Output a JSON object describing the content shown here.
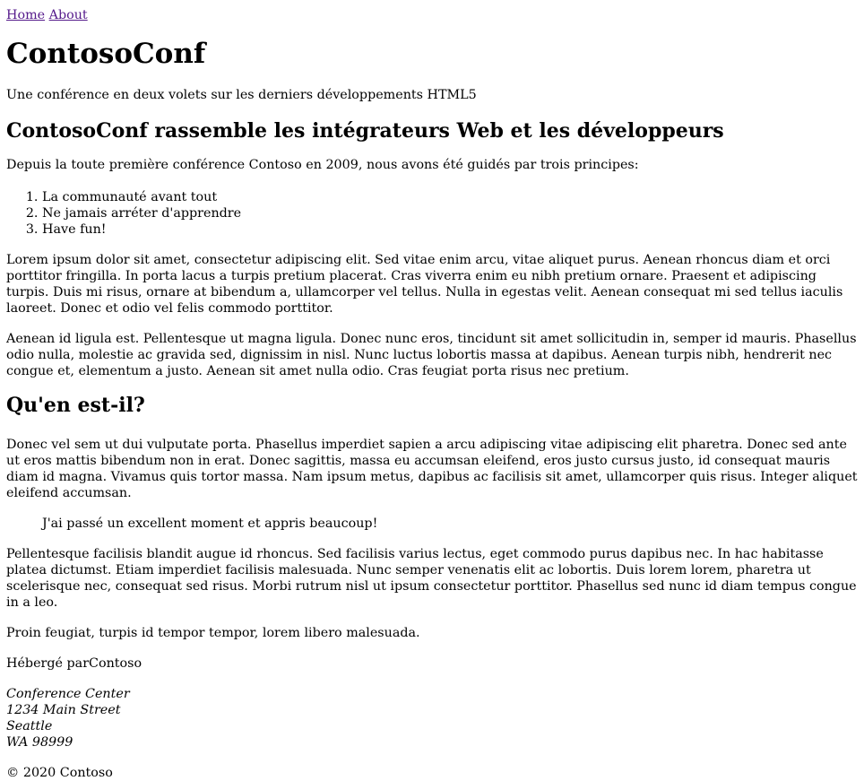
{
  "nav": {
    "home": "Home",
    "about": "About"
  },
  "header": {
    "title": "ContosoConf",
    "tagline": "Une conférence en deux volets sur les derniers développements HTML5"
  },
  "section1": {
    "heading": "ContosoConf rassemble les intégrateurs Web et les développeurs",
    "intro": "Depuis la toute première conférence Contoso en 2009, nous avons été guidés par trois principes:",
    "principles": [
      "La communauté avant tout",
      "Ne jamais arréter d'apprendre",
      "Have fun!"
    ],
    "p1": "Lorem ipsum dolor sit amet, consectetur adipiscing elit. Sed vitae enim arcu, vitae aliquet purus. Aenean rhoncus diam et orci porttitor fringilla. In porta lacus a turpis pretium placerat. Cras viverra enim eu nibh pretium ornare. Praesent et adipiscing turpis. Duis mi risus, ornare at bibendum a, ullamcorper vel tellus. Nulla in egestas velit. Aenean consequat mi sed tellus iaculis laoreet. Donec et odio vel felis commodo porttitor.",
    "p2": "Aenean id ligula est. Pellentesque ut magna ligula. Donec nunc eros, tincidunt sit amet sollicitudin in, semper id mauris. Phasellus odio nulla, molestie ac gravida sed, dignissim in nisl. Nunc luctus lobortis massa at dapibus. Aenean turpis nibh, hendrerit nec congue et, elementum a justo. Aenean sit amet nulla odio. Cras feugiat porta risus nec pretium."
  },
  "section2": {
    "heading": "Qu'en est-il?",
    "p1": "Donec vel sem ut dui vulputate porta. Phasellus imperdiet sapien a arcu adipiscing vitae adipiscing elit pharetra. Donec sed ante ut eros mattis bibendum non in erat. Donec sagittis, massa eu accumsan eleifend, eros justo cursus justo, id consequat mauris diam id magna. Vivamus quis tortor massa. Nam ipsum metus, dapibus ac facilisis sit amet, ullamcorper quis risus. Integer aliquet eleifend accumsan.",
    "quote": "J'ai passé un excellent moment et appris beaucoup!",
    "p2": "Pellentesque facilisis blandit augue id rhoncus. Sed facilisis varius lectus, eget commodo purus dapibus nec. In hac habitasse platea dictumst. Etiam imperdiet facilisis malesuada. Nunc semper venenatis elit ac lobortis. Duis lorem lorem, pharetra ut scelerisque nec, consequat sed risus. Morbi rutrum nisl ut ipsum consectetur porttitor. Phasellus sed nunc id diam tempus congue in a leo.",
    "p3": "Proin feugiat, turpis id tempor tempor, lorem libero malesuada."
  },
  "footer": {
    "hosted_label": "Hébergé par",
    "hosted_name": "Contoso",
    "address": [
      "Conference Center",
      "1234 Main Street",
      "Seattle",
      "WA 98999"
    ],
    "copyright": "© 2020 Contoso"
  },
  "colors": {
    "link": "#551a8b",
    "text": "#000000",
    "background": "#ffffff"
  }
}
